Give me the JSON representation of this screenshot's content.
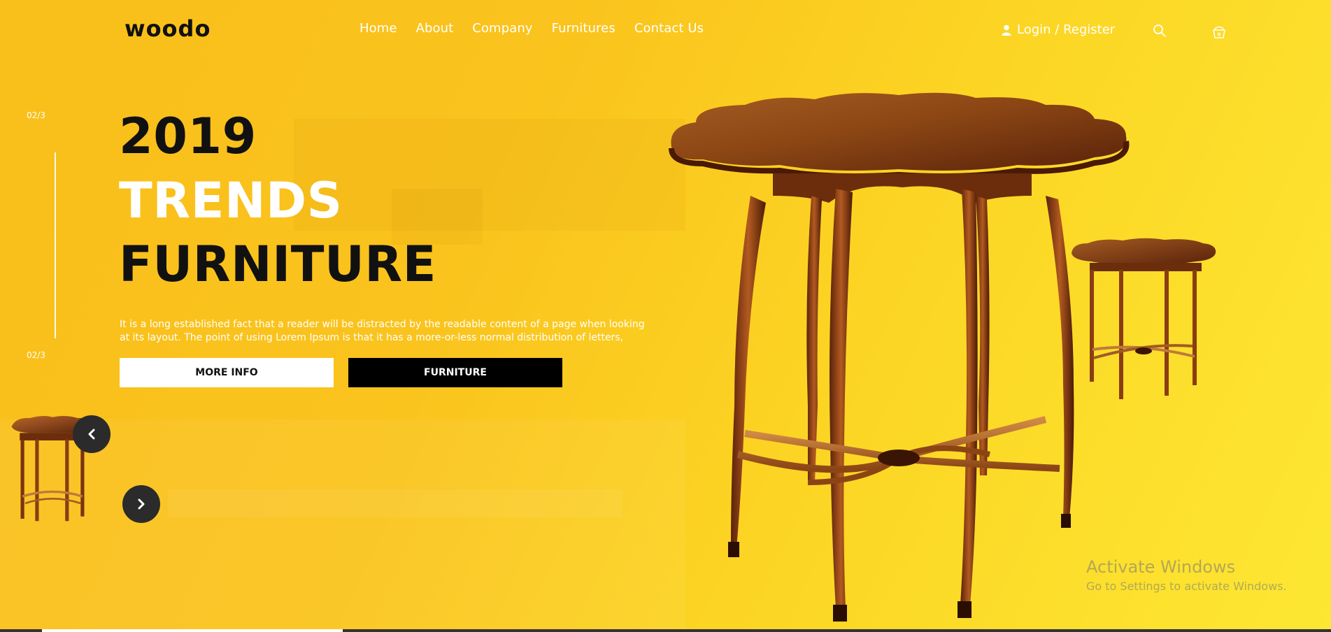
{
  "header": {
    "logo": "woodo",
    "nav": [
      "Home",
      "About",
      "Company",
      "Furnitures",
      "Contact Us"
    ],
    "login_label": "Login / Register",
    "cart_count": "0",
    "icons": {
      "user": "user-icon",
      "search": "search-icon",
      "cart": "shopping-bag-icon"
    }
  },
  "slider": {
    "counter_top": "02/3",
    "counter_bottom": "02/3",
    "heading": {
      "year": "2019",
      "line2": "TRENDS",
      "line3": "FURNITURE"
    },
    "description": "It is a long established fact that a reader will be distracted by the readable content of a page when looking at its layout. The point of using Lorem Ipsum is that it has a more-or-less normal distribution of letters,",
    "buttons": {
      "more_info": "MORE INFO",
      "furniture": "FURNITURE"
    },
    "arrows": {
      "prev": "chevron-left-icon",
      "next": "chevron-right-icon"
    }
  },
  "watermark": {
    "title": "Activate Windows",
    "subtitle": "Go to Settings to activate Windows."
  },
  "colors": {
    "background_start": "#f9bf1b",
    "background_end": "#fde733",
    "dark": "#111111",
    "white": "#ffffff",
    "wood": "#8a3d12"
  }
}
